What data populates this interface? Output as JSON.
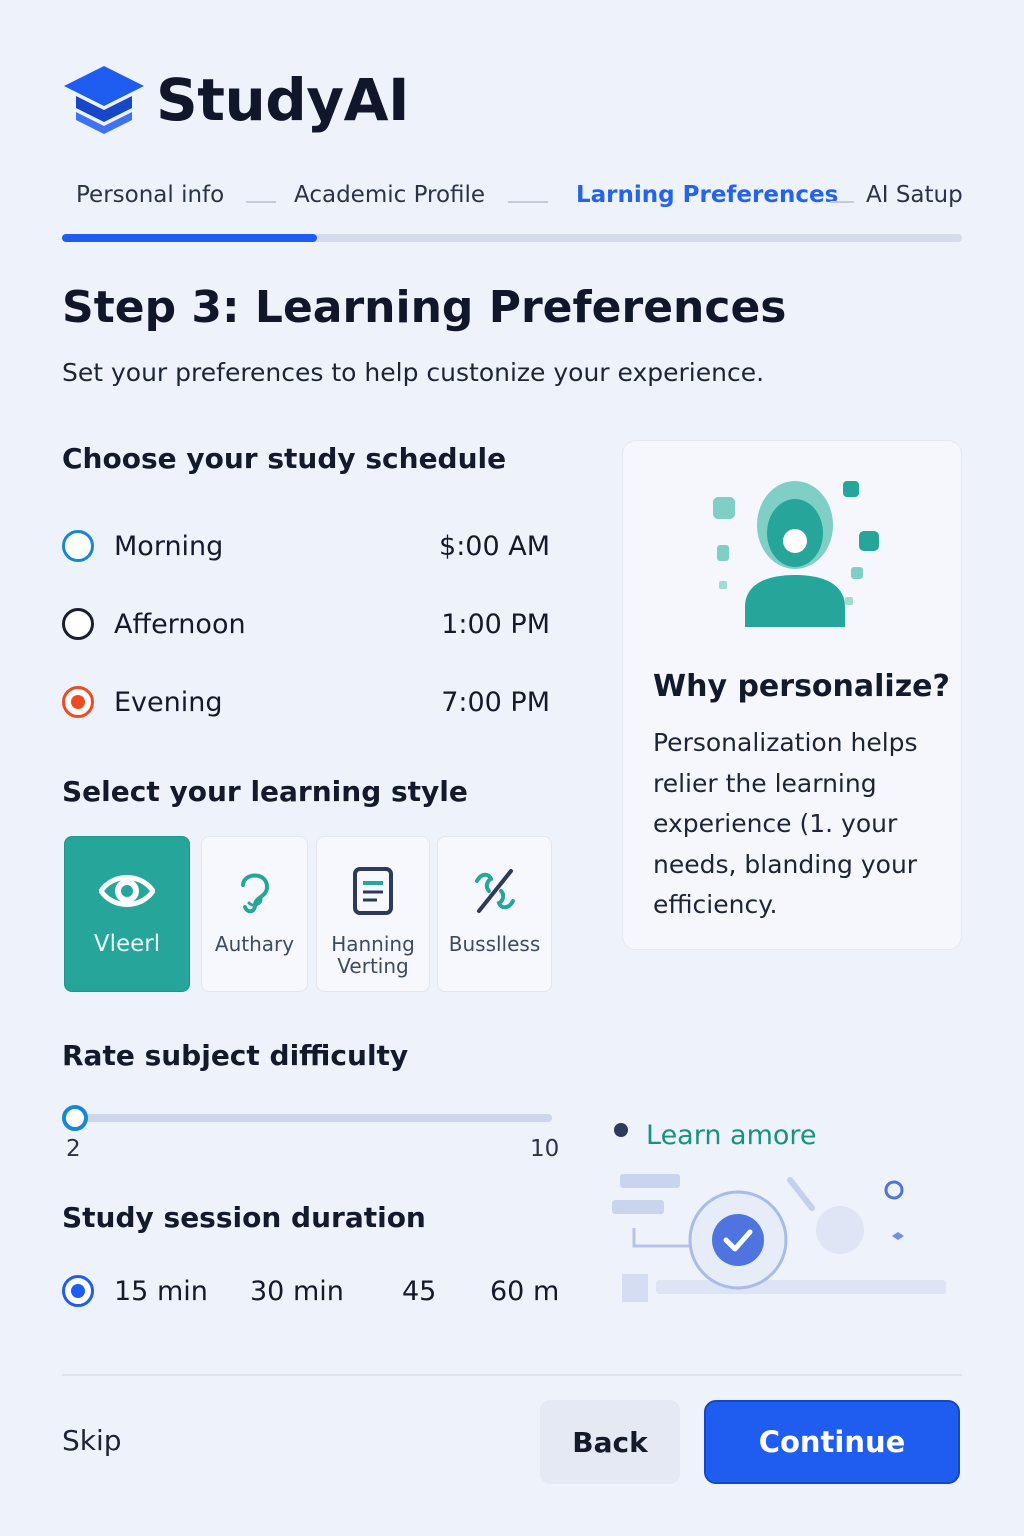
{
  "app": {
    "name": "StudyAI",
    "logo_icon": "graduation-cap-icon",
    "brand_color": "#1f5cf0"
  },
  "stepper": {
    "steps": [
      {
        "label": "Personal info",
        "state": "done"
      },
      {
        "label": "Academic Profile",
        "state": "done"
      },
      {
        "label": "Larning Preferences",
        "state": "active"
      },
      {
        "label": "AI Satup",
        "state": "upcoming"
      }
    ],
    "progress_fraction": 0.283
  },
  "page": {
    "title": "Step 3: Learning Preferences",
    "subtitle": "Set your preferences to help custonize your experience."
  },
  "schedule": {
    "title": "Choose your study schedule",
    "options": [
      {
        "label": "Morning",
        "time": "$:00 AM",
        "selected": false
      },
      {
        "label": "Affernoon",
        "time": "1:00 PM",
        "selected": false
      },
      {
        "label": "Evening",
        "time": "7:00 PM",
        "selected": true
      }
    ]
  },
  "learning_style": {
    "title": "Select your learning style",
    "options": [
      {
        "label": "Vleerl",
        "icon": "eye-icon",
        "selected": true
      },
      {
        "label": "Authary",
        "icon": "ear-icon",
        "selected": false
      },
      {
        "label": "Hanning Verting",
        "icon": "document-icon",
        "selected": false
      },
      {
        "label": "Busslless",
        "icon": "hands-icon",
        "selected": false
      }
    ]
  },
  "difficulty": {
    "title": "Rate subject difficulty",
    "min_label": "2",
    "max_label": "10",
    "value": 2
  },
  "duration": {
    "title": "Study session duration",
    "options": [
      {
        "label": "15 min",
        "selected": true
      },
      {
        "label": "30 min",
        "selected": false
      },
      {
        "label": "45",
        "selected": false
      },
      {
        "label": "60 m",
        "selected": false
      }
    ]
  },
  "info_card": {
    "title": "Why personalize?",
    "body": "Personalization helps relier the learning experience (1. your needs, blanding your efficiency.",
    "illustration_icon": "ai-person-icon",
    "accent": "#26a59b"
  },
  "learn_more": {
    "label": "Learn amore",
    "icon": "check-badge-icon"
  },
  "footer": {
    "skip_label": "Skip",
    "back_label": "Back",
    "continue_label": "Continue"
  }
}
